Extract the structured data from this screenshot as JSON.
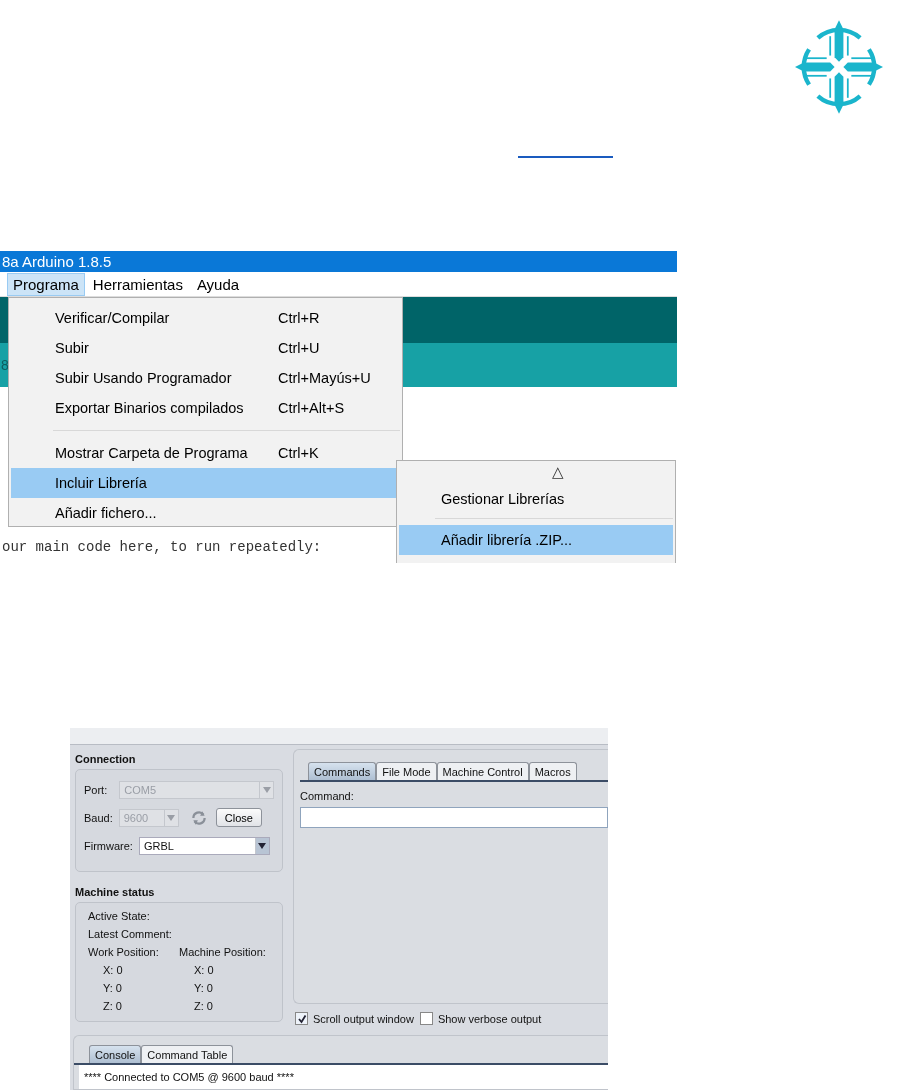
{
  "arduino": {
    "title": "8a Arduino 1.8.5",
    "menubar": [
      {
        "label": "Programa",
        "selected": true
      },
      {
        "label": "Herramientas",
        "selected": false
      },
      {
        "label": "Ayuda",
        "selected": false
      }
    ],
    "tab_fragment": "8",
    "code_line": "our main code here, to run repeatedly:",
    "menu": [
      {
        "kind": "item",
        "label": "Verificar/Compilar",
        "shortcut": "Ctrl+R",
        "selected": false
      },
      {
        "kind": "item",
        "label": "Subir",
        "shortcut": "Ctrl+U",
        "selected": false
      },
      {
        "kind": "item",
        "label": "Subir Usando Programador",
        "shortcut": "Ctrl+Mayús+U",
        "selected": false
      },
      {
        "kind": "item",
        "label": "Exportar Binarios compilados",
        "shortcut": "Ctrl+Alt+S",
        "selected": false
      },
      {
        "kind": "separator"
      },
      {
        "kind": "item",
        "label": "Mostrar Carpeta de Programa",
        "shortcut": "Ctrl+K",
        "selected": false
      },
      {
        "kind": "item",
        "label": "Incluir Librería",
        "selected": true
      },
      {
        "kind": "item",
        "label": "Añadir fichero...",
        "selected": false
      }
    ],
    "submenu": [
      {
        "kind": "scroll",
        "label": "△"
      },
      {
        "kind": "item",
        "label": "Gestionar Librerías",
        "selected": false
      },
      {
        "kind": "separator"
      },
      {
        "kind": "item",
        "label": "Añadir librería .ZIP...",
        "selected": true
      }
    ]
  },
  "ugs": {
    "connection": {
      "title": "Connection",
      "port": {
        "label": "Port:",
        "value": "COM5",
        "disabled": true
      },
      "baud": {
        "label": "Baud:",
        "value": "9600",
        "disabled": true
      },
      "close_button": "Close",
      "firmware": {
        "label": "Firmware:",
        "value": "GRBL",
        "disabled": false
      }
    },
    "machine_status": {
      "title": "Machine status",
      "active_state": "Active State:",
      "latest_comment": "Latest Comment:",
      "work_position": "Work Position:",
      "machine_position": "Machine Position:",
      "axes": [
        {
          "work": "X:  0",
          "machine": "X:  0"
        },
        {
          "work": "Y:  0",
          "machine": "Y:  0"
        },
        {
          "work": "Z:  0",
          "machine": "Z:  0"
        }
      ]
    },
    "tabs": [
      {
        "label": "Commands",
        "selected": true
      },
      {
        "label": "File Mode",
        "selected": false
      },
      {
        "label": "Machine Control",
        "selected": false
      },
      {
        "label": "Macros",
        "selected": false
      }
    ],
    "command_label": "Command:",
    "checkboxes": [
      {
        "label": "Scroll output window",
        "checked": true
      },
      {
        "label": "Show verbose output",
        "checked": false
      }
    ],
    "console_tabs": [
      {
        "label": "Console",
        "selected": true
      },
      {
        "label": "Command Table",
        "selected": false
      }
    ],
    "console_lines": [
      "**** Connected to COM5 @ 9600 baud ****"
    ]
  }
}
